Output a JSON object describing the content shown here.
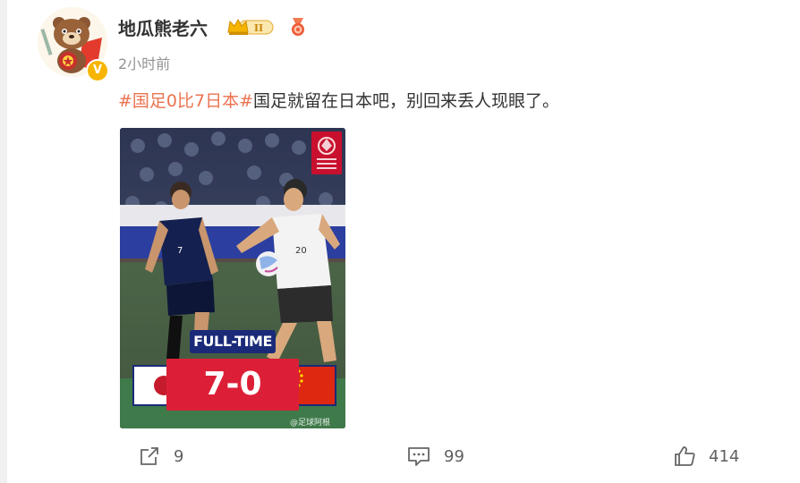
{
  "post": {
    "username": "地瓜熊老六",
    "badge_level": "II",
    "verified_mark": "V",
    "timestamp": "2小时前",
    "hashtag": "#国足0比7日本#",
    "text": "国足就留在日本吧，别回来丢人现眼了。"
  },
  "image": {
    "fulltime_label": "FULL-TIME",
    "score": "7-0",
    "watermark": "@足球阿根"
  },
  "actions": {
    "repost_count": "9",
    "comment_count": "99",
    "like_count": "414"
  },
  "colors": {
    "hashtag": "#eb7350",
    "score_red": "#dc1f37",
    "navy": "#1a2a78"
  }
}
